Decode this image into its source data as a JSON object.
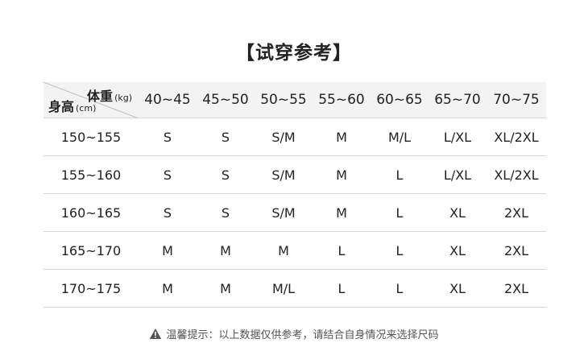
{
  "title": "【试穿参考】",
  "header": {
    "corner_weight": "体重",
    "corner_weight_unit": "(kg)",
    "corner_height": "身高",
    "corner_height_unit": "(cm)",
    "weights": [
      "40~45",
      "45~50",
      "50~55",
      "55~60",
      "60~65",
      "65~70",
      "70~75"
    ]
  },
  "rows": [
    {
      "height": "150~155",
      "sizes": [
        "S",
        "S",
        "S/M",
        "M",
        "M/L",
        "L/XL",
        "XL/2XL"
      ]
    },
    {
      "height": "155~160",
      "sizes": [
        "S",
        "S",
        "S/M",
        "M",
        "L",
        "L/XL",
        "XL/2XL"
      ]
    },
    {
      "height": "160~165",
      "sizes": [
        "S",
        "S",
        "S/M",
        "M",
        "L",
        "XL",
        "2XL"
      ]
    },
    {
      "height": "165~170",
      "sizes": [
        "M",
        "M",
        "M",
        "L",
        "L",
        "XL",
        "2XL"
      ]
    },
    {
      "height": "170~175",
      "sizes": [
        "M",
        "M",
        "M/L",
        "L",
        "L",
        "XL",
        "2XL"
      ]
    }
  ],
  "tip": "温馨提示：以上数据仅供参考，请结合自身情况来选择尺码",
  "icons": {
    "tip_icon": "warning-icon"
  },
  "colors": {
    "header_bg": "#f3f3f3",
    "divider": "#d6d6d6",
    "text": "#222222",
    "tip_text": "#555555"
  }
}
